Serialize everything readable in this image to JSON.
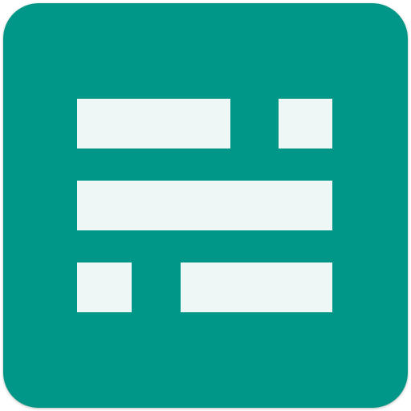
{
  "icon": {
    "name": "form-lines-app-icon",
    "background_color": "#009688",
    "bar_color": "#EEF6F6",
    "rows": [
      {
        "bars": [
          "long",
          "short"
        ]
      },
      {
        "bars": [
          "full"
        ]
      },
      {
        "bars": [
          "short",
          "long"
        ]
      }
    ]
  }
}
